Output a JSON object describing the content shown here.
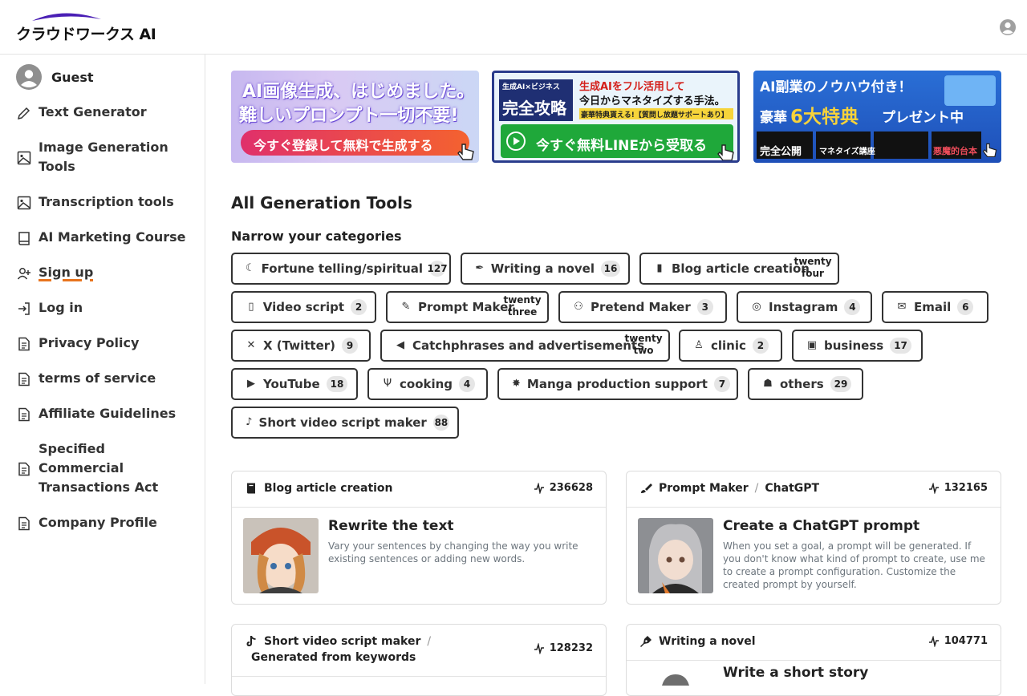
{
  "header": {
    "logo_text": "クラウドワークス AI",
    "logo_icon": "brand-arc",
    "account_icon": "user-circle-icon"
  },
  "sidebar": {
    "guest_label": "Guest",
    "items": [
      {
        "label": "Text Generator",
        "icon": "pencil-icon"
      },
      {
        "label": "Image Generation Tools",
        "icon": "image-icon"
      },
      {
        "label": "Transcription tools",
        "icon": "image-icon"
      },
      {
        "label": "AI Marketing Course",
        "icon": "book-icon"
      },
      {
        "label": "Sign up",
        "icon": "user-plus-icon"
      },
      {
        "label": "Log in",
        "icon": "login-icon"
      },
      {
        "label": "Privacy Policy",
        "icon": "document-icon"
      },
      {
        "label": "terms of service",
        "icon": "document-icon"
      },
      {
        "label": "Affiliate Guidelines",
        "icon": "document-icon"
      },
      {
        "label": "Specified Commercial Transactions Act",
        "icon": "document-icon"
      },
      {
        "label": "Company Profile",
        "icon": "document-icon"
      }
    ],
    "accent_color": "#e8741e"
  },
  "banners": [
    {
      "line1": "AI画像生成、はじめました。",
      "line2": "難しいプロンプト一切不要!",
      "cta": "今すぐ登録して無料で生成する"
    },
    {
      "tag": "生成AI×ビジネス",
      "big": "完全攻略",
      "line1": "生成AIをフル活用して",
      "line2": "今日からマネタイズする手法。",
      "note": "豪華特典貰える!【質問し放題サポートあり】",
      "cta": "今すぐ無料LINEから受取る"
    },
    {
      "line1": "AI副業のノウハウ付き！",
      "line2": "豪華",
      "big": "6大特典",
      "line3": "プレゼント中",
      "box1": "完全公開",
      "box2": "マネタイズ講座",
      "box3": "悪魔的台本"
    }
  ],
  "main": {
    "title": "All Generation Tools",
    "narrow_label": "Narrow your categories"
  },
  "categories": [
    {
      "label": "Fortune telling/spiritual",
      "count": "127",
      "icon": "☾"
    },
    {
      "label": "Writing a novel",
      "count": "16",
      "icon": "✒"
    },
    {
      "label": "Blog article creation",
      "count": "twenty four",
      "icon": "▮"
    },
    {
      "label": "Video script",
      "count": "2",
      "icon": "▯"
    },
    {
      "label": "Prompt Maker",
      "count": "twenty three",
      "icon": "✎"
    },
    {
      "label": "Pretend Maker",
      "count": "3",
      "icon": "⚇"
    },
    {
      "label": "Instagram",
      "count": "4",
      "icon": "◎"
    },
    {
      "label": "Email",
      "count": "6",
      "icon": "✉"
    },
    {
      "label": "X (Twitter)",
      "count": "9",
      "icon": "✕"
    },
    {
      "label": "Catchphrases and advertisements",
      "count": "twenty two",
      "icon": "◀"
    },
    {
      "label": "clinic",
      "count": "2",
      "icon": "♙"
    },
    {
      "label": "business",
      "count": "17",
      "icon": "▣"
    },
    {
      "label": "YouTube",
      "count": "18",
      "icon": "▶"
    },
    {
      "label": "cooking",
      "count": "4",
      "icon": "Ψ"
    },
    {
      "label": "Manga production support",
      "count": "7",
      "icon": "✸"
    },
    {
      "label": "others",
      "count": "29",
      "icon": "☗"
    },
    {
      "label": "Short video script maker",
      "count": "88",
      "icon": "♪"
    }
  ],
  "cards": [
    {
      "category": "Blog article creation",
      "sub": "",
      "views": "236628",
      "title": "Rewrite the text",
      "desc": "Vary your sentences by changing the way you write existing sentences or adding new words.",
      "icon": "book-icon"
    },
    {
      "category": "Prompt Maker",
      "sub": "ChatGPT",
      "views": "132165",
      "title": "Create a ChatGPT prompt",
      "desc": "When you set a goal, a prompt will be generated. If you don't know what kind of prompt to create, use me to create a prompt configuration. Customize the created prompt by yourself.",
      "icon": "brush-icon"
    },
    {
      "category": "Short video script maker",
      "sub": "Generated from keywords",
      "views": "128232",
      "title": "",
      "desc": "",
      "icon": "tiktok-icon"
    },
    {
      "category": "Writing a novel",
      "sub": "",
      "views": "104771",
      "title": "Write a short story",
      "desc": "",
      "icon": "pen-nib-icon"
    }
  ]
}
